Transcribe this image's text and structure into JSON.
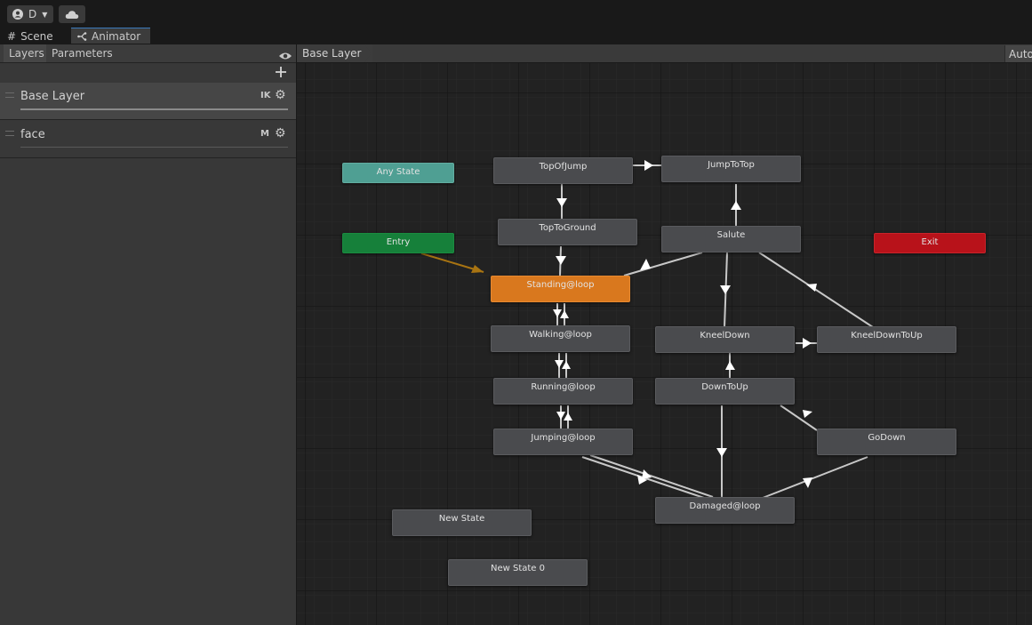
{
  "toolbar": {
    "account_initial": "D"
  },
  "tabs": [
    {
      "label": "Scene"
    },
    {
      "label": "Animator"
    }
  ],
  "panel": {
    "tabs": [
      {
        "label": "Layers"
      },
      {
        "label": "Parameters"
      }
    ],
    "layers": [
      {
        "name": "Base Layer",
        "badge": "IK"
      },
      {
        "name": "face",
        "badge": "M"
      }
    ]
  },
  "graph": {
    "breadcrumb": "Base Layer",
    "auto_label": "Auto",
    "states": {
      "any_state": "Any State",
      "entry": "Entry",
      "exit": "Exit",
      "top_of_jump": "TopOfJump",
      "jump_to_top": "JumpToTop",
      "top_to_ground": "TopToGround",
      "salute": "Salute",
      "standing": "Standing@loop",
      "walking": "Walking@loop",
      "kneel_down": "KneelDown",
      "kneel_down_to_up": "KneelDownToUp",
      "running": "Running@loop",
      "down_to_up": "DownToUp",
      "jumping": "Jumping@loop",
      "go_down": "GoDown",
      "damaged": "Damaged@loop",
      "new_state": "New State",
      "new_state_0": "New State 0"
    },
    "colors": {
      "default_state": "#4a4b4e",
      "default_state_node": "#d9781e",
      "entry": "#16803a",
      "any_state": "#4f9f93",
      "exit": "#b8121a",
      "transition": "#c8c8c8",
      "entry_transition": "#a87412"
    }
  }
}
